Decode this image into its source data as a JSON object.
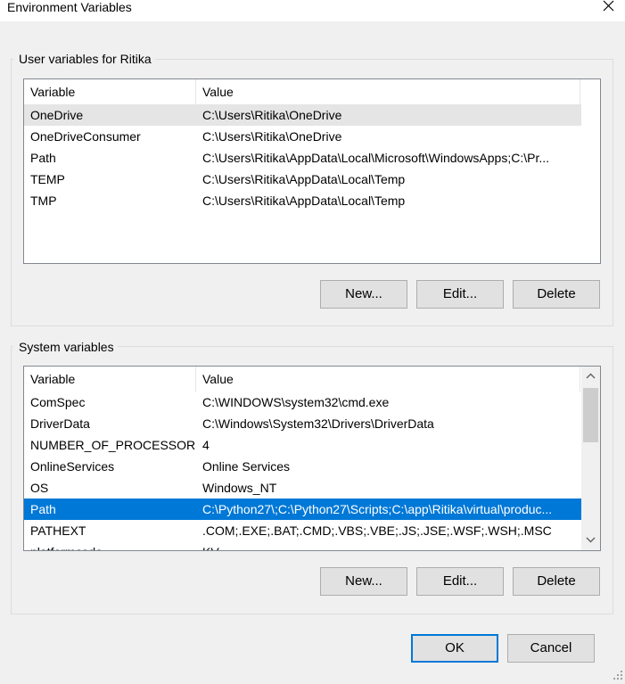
{
  "window": {
    "title": "Environment Variables",
    "close_icon": "close-icon"
  },
  "user_section": {
    "label": "User variables for Ritika",
    "columns": {
      "variable": "Variable",
      "value": "Value"
    },
    "rows": [
      {
        "variable": "OneDrive",
        "value": "C:\\Users\\Ritika\\OneDrive",
        "state": "hover"
      },
      {
        "variable": "OneDriveConsumer",
        "value": "C:\\Users\\Ritika\\OneDrive",
        "state": ""
      },
      {
        "variable": "Path",
        "value": "C:\\Users\\Ritika\\AppData\\Local\\Microsoft\\WindowsApps;C:\\Pr...",
        "state": ""
      },
      {
        "variable": "TEMP",
        "value": "C:\\Users\\Ritika\\AppData\\Local\\Temp",
        "state": ""
      },
      {
        "variable": "TMP",
        "value": "C:\\Users\\Ritika\\AppData\\Local\\Temp",
        "state": ""
      }
    ],
    "buttons": {
      "new": "New...",
      "edit": "Edit...",
      "delete": "Delete"
    }
  },
  "system_section": {
    "label": "System variables",
    "columns": {
      "variable": "Variable",
      "value": "Value"
    },
    "rows": [
      {
        "variable": "ComSpec",
        "value": "C:\\WINDOWS\\system32\\cmd.exe",
        "state": ""
      },
      {
        "variable": "DriverData",
        "value": "C:\\Windows\\System32\\Drivers\\DriverData",
        "state": ""
      },
      {
        "variable": "NUMBER_OF_PROCESSORS",
        "value": "4",
        "state": ""
      },
      {
        "variable": "OnlineServices",
        "value": "Online Services",
        "state": ""
      },
      {
        "variable": "OS",
        "value": "Windows_NT",
        "state": ""
      },
      {
        "variable": "Path",
        "value": "C:\\Python27\\;C:\\Python27\\Scripts;C:\\app\\Ritika\\virtual\\produc...",
        "state": "selected"
      },
      {
        "variable": "PATHEXT",
        "value": ".COM;.EXE;.BAT;.CMD;.VBS;.VBE;.JS;.JSE;.WSF;.WSH;.MSC",
        "state": ""
      },
      {
        "variable": "platformcode",
        "value": "KV",
        "state": ""
      }
    ],
    "buttons": {
      "new": "New...",
      "edit": "Edit...",
      "delete": "Delete"
    }
  },
  "footer": {
    "ok": "OK",
    "cancel": "Cancel"
  },
  "colors": {
    "selection": "#0078d7",
    "hover": "#e5e5e5",
    "dialog_bg": "#f0f0f0",
    "button_bg": "#e1e1e1"
  },
  "icons": {
    "scroll_up": "chevron-up-icon",
    "scroll_down": "chevron-down-icon",
    "resize_grip": "resize-grip-icon"
  }
}
